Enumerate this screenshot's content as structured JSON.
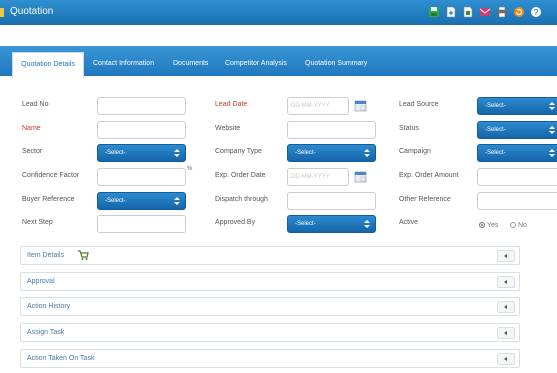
{
  "window": {
    "title": "Quotation"
  },
  "toolbar": {
    "icons": [
      "save-icon",
      "export-icon",
      "copy-icon",
      "email-icon",
      "print-icon",
      "refresh-icon",
      "help-icon"
    ],
    "colors": {
      "save": "#2ea84a",
      "email": "#d13b6f",
      "print": "#6c6c6c",
      "refresh": "#f28c1c",
      "help": "#1a6fb0"
    }
  },
  "tabs": [
    "Quotation Details",
    "Contact Information",
    "Documents",
    "Competitor Analysis",
    "Quotation Summary"
  ],
  "form": {
    "lead_no": {
      "label": "Lead No"
    },
    "lead_date": {
      "label": "Lead Date",
      "placeholder": "DD-MM-YYYY"
    },
    "lead_source": {
      "label": "Lead Source",
      "value": "-Select-"
    },
    "name": {
      "label": "Name"
    },
    "website": {
      "label": "Website"
    },
    "status": {
      "label": "Status",
      "value": "-Select-"
    },
    "sector": {
      "label": "Sector",
      "value": "-Select-"
    },
    "company_type": {
      "label": "Company Type",
      "value": "-Select-"
    },
    "campaign": {
      "label": "Campaign",
      "value": "-Select-"
    },
    "confidence_factor": {
      "label": "Confidence Factor",
      "unit": "%"
    },
    "exp_order_date": {
      "label": "Exp. Order Date",
      "placeholder": "DD-MM-YYYY"
    },
    "exp_order_amount": {
      "label": "Exp. Order Amount"
    },
    "buyer_reference": {
      "label": "Buyer Reference",
      "value": "-Select-"
    },
    "dispatch_through": {
      "label": "Dispatch through"
    },
    "other_reference": {
      "label": "Other Reference"
    },
    "next_step": {
      "label": "Next Step"
    },
    "approved_by": {
      "label": "Approved By",
      "value": "-Select-"
    },
    "active": {
      "label": "Active",
      "options": [
        "Yes",
        "No"
      ],
      "selected": "Yes"
    }
  },
  "panels": [
    "Item Details",
    "Approval",
    "Action History",
    "Assign Task",
    "Action Taken On Task"
  ],
  "icons": {
    "item_details": "cart-icon",
    "date_picker": "calendar-icon"
  }
}
